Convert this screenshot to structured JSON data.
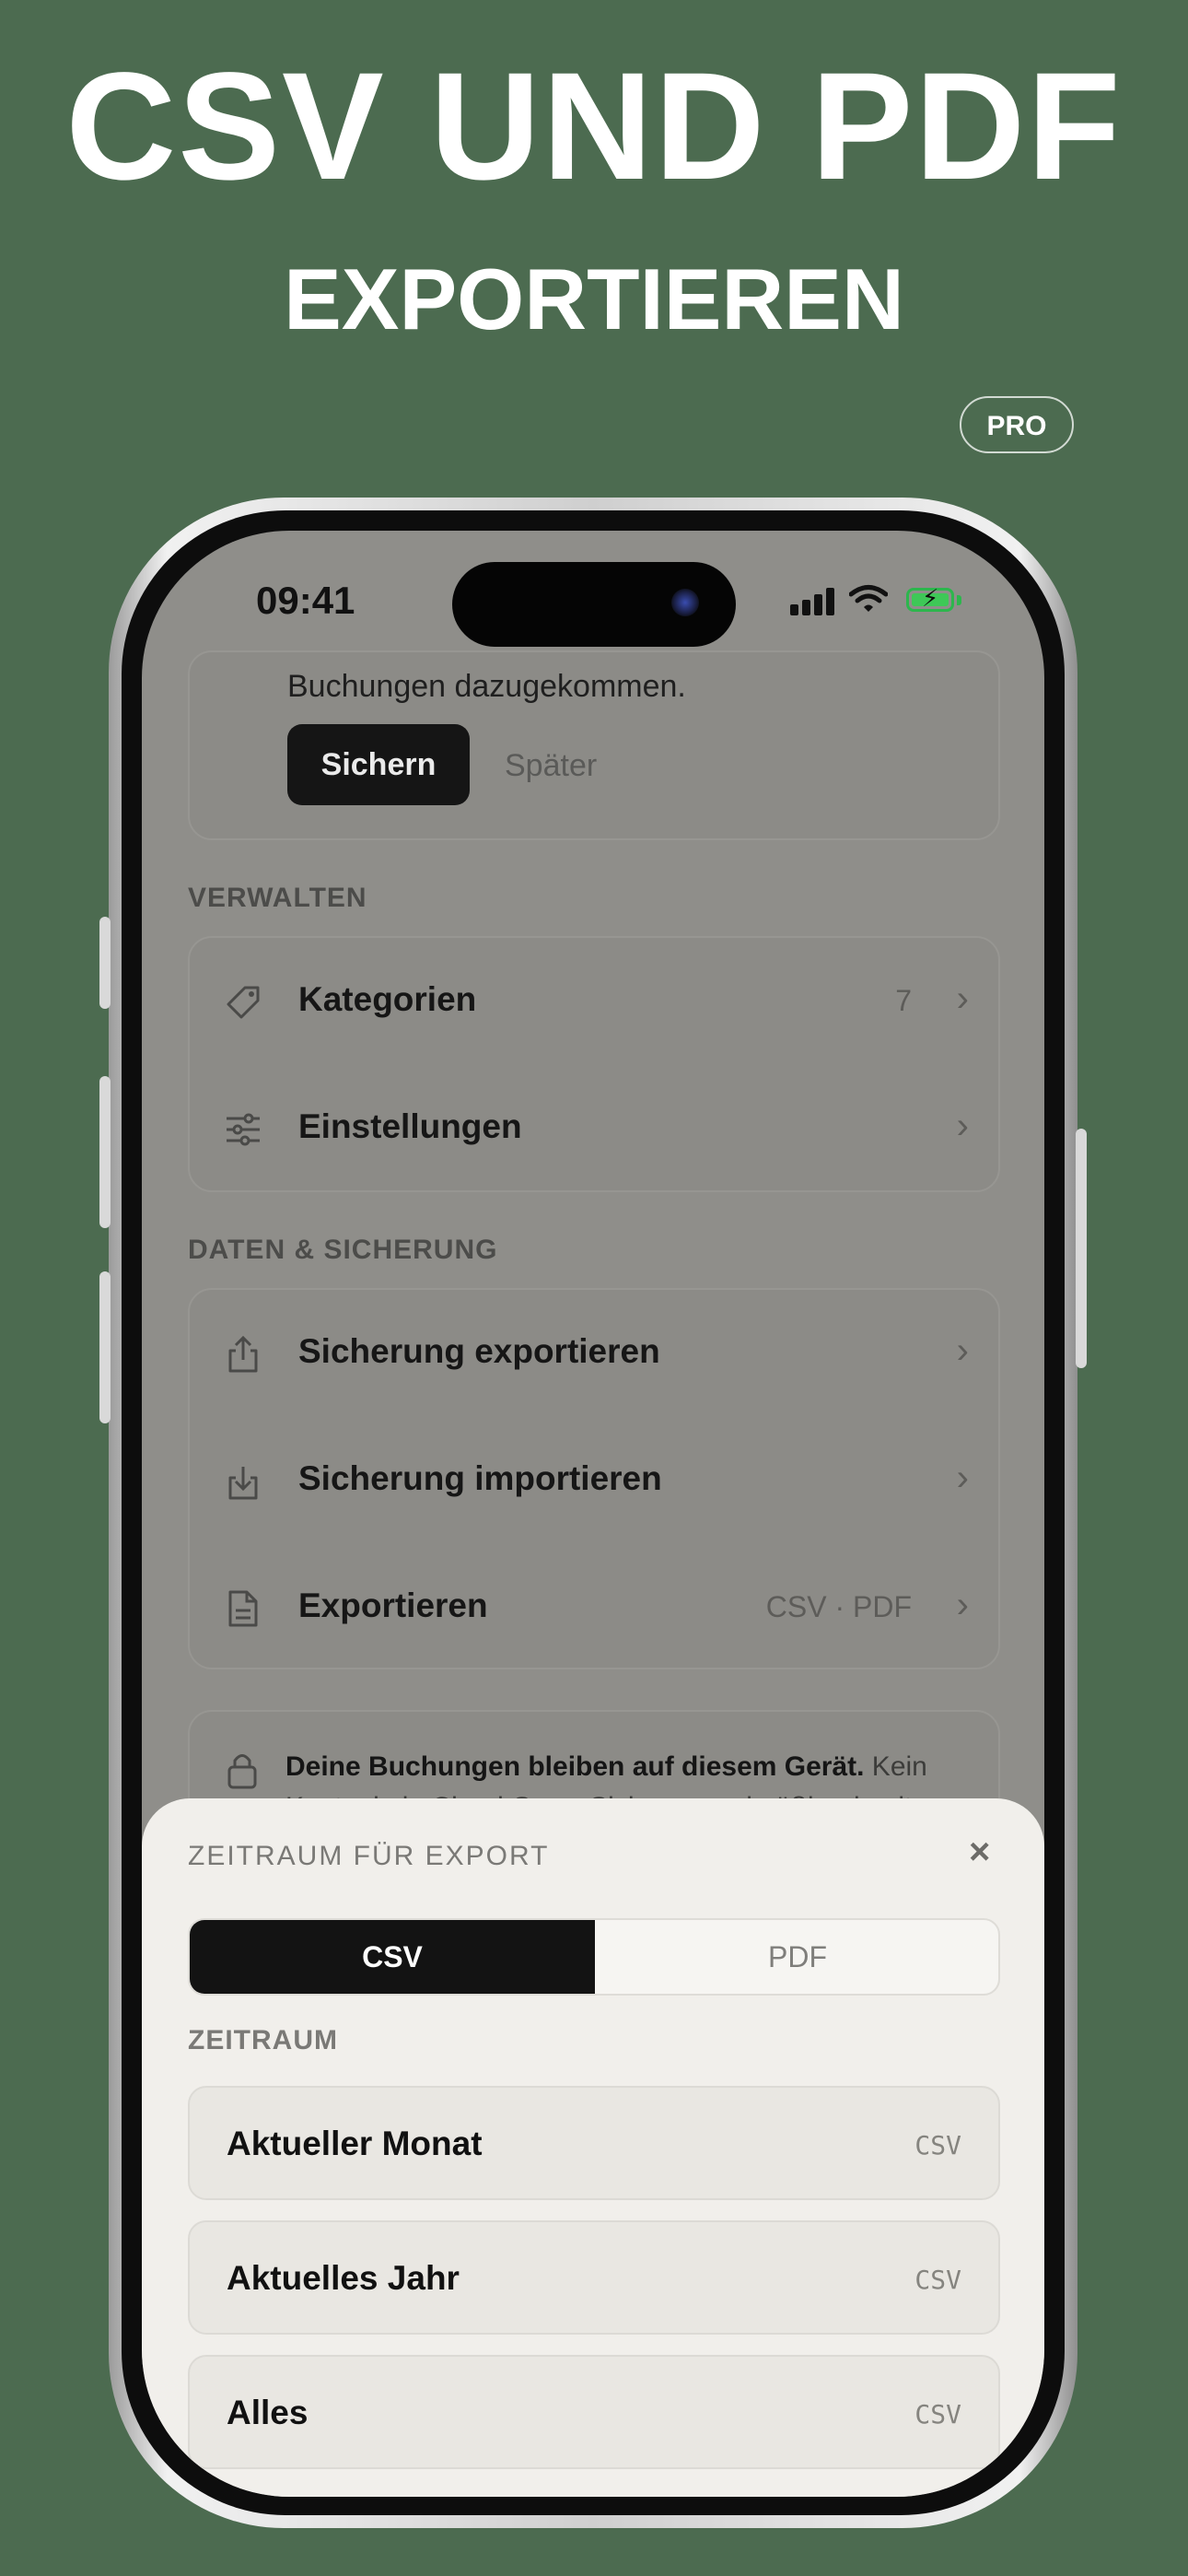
{
  "hero": {
    "title": "CSV UND PDF",
    "subtitle": "EXPORTIEREN",
    "badge": "PRO"
  },
  "status_bar": {
    "time": "09:41",
    "signal": "signal-icon",
    "wifi": "wifi-icon",
    "battery": "battery-charging-icon"
  },
  "backup_card": {
    "text": "Buchungen dazugekommen.",
    "primary_button": "Sichern",
    "secondary_button": "Später"
  },
  "manage_section": {
    "header": "VERWALTEN",
    "items": [
      {
        "label": "Kategorien",
        "value": "7",
        "icon": "tag-icon"
      },
      {
        "label": "Einstellungen",
        "value": "",
        "icon": "sliders-icon"
      }
    ]
  },
  "data_section": {
    "header": "DATEN & SICHERUNG",
    "items": [
      {
        "label": "Sicherung exportieren",
        "value": "",
        "icon": "share-icon"
      },
      {
        "label": "Sicherung importieren",
        "value": "",
        "icon": "import-icon"
      },
      {
        "label": "Exportieren",
        "value": "CSV · PDF",
        "icon": "document-icon"
      }
    ]
  },
  "privacy_note": {
    "bold": "Deine Buchungen bleiben auf diesem Gerät.",
    "rest": " Kein Konto, kein Cloud-Sync. Sichere regelmäßig, damit"
  },
  "export_sheet": {
    "title": "ZEITRAUM FÜR EXPORT",
    "close": "×",
    "segments": [
      "CSV",
      "PDF"
    ],
    "selected_segment": "CSV",
    "section_header": "ZEITRAUM",
    "options": [
      {
        "label": "Aktueller Monat",
        "tag": "CSV"
      },
      {
        "label": "Aktuelles Jahr",
        "tag": "CSV"
      },
      {
        "label": "Alles",
        "tag": "CSV"
      }
    ]
  }
}
